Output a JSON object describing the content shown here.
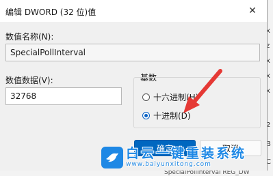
{
  "dialog": {
    "title": "编辑 DWORD (32 位)值",
    "close_glyph": "✕",
    "value_name_label": "数值名称(N):",
    "value_name": "SpecialPollInterval",
    "value_data_label": "数值数据(V):",
    "value_data": "32768",
    "base_label": "基数",
    "base_options": [
      {
        "label": "十六进制(H)",
        "checked": false
      },
      {
        "label": "十进制(D)",
        "checked": true
      }
    ],
    "ok_label": "确定",
    "cancel_label": "取消"
  },
  "background_window": {
    "right_strip_chars": [
      "x",
      "z",
      "x",
      "x",
      "x",
      "2",
      "B",
      "C"
    ],
    "bottom_text": "SpecialPollInterval  REG_DW"
  },
  "watermark": {
    "text": "白云一键重装系统",
    "url": "www.baiyunxitong.com"
  },
  "colors": {
    "accent": "#0067c0",
    "arrow": "#e53935",
    "watermark": "#1e88e5"
  }
}
